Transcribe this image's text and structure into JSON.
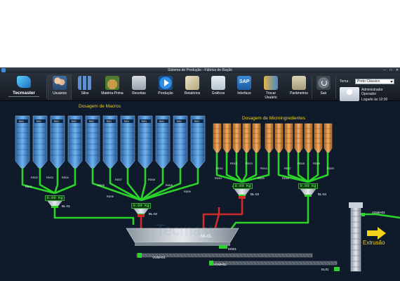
{
  "window": {
    "title": "Sistema de Produção - Fábrica de Ração"
  },
  "toolbar": {
    "logo": "Tecmaster",
    "buttons": [
      {
        "id": "usuarios",
        "label": "Usuários",
        "icon": "users-icon"
      },
      {
        "id": "silos",
        "label": "Silos",
        "icon": "silos-icon"
      },
      {
        "id": "materia_prima",
        "label": "Matéria-Prima",
        "icon": "raw-material-icon"
      },
      {
        "id": "receitas",
        "label": "Receitas",
        "icon": "recipes-icon"
      },
      {
        "id": "producao",
        "label": "Produção",
        "icon": "play-icon"
      },
      {
        "id": "relatorios",
        "label": "Relatórios",
        "icon": "reports-icon"
      },
      {
        "id": "graficos",
        "label": "Gráficos",
        "icon": "charts-icon"
      },
      {
        "id": "interface",
        "label": "Interface",
        "icon": "sap-icon"
      },
      {
        "id": "trocar_usuario",
        "label": "Trocar\nUsuário",
        "icon": "switch-user-icon"
      },
      {
        "id": "parametros",
        "label": "Parâmetros",
        "icon": "settings-icon"
      },
      {
        "id": "sair",
        "label": "Sair",
        "icon": "power-icon"
      }
    ],
    "sap_text": "SAP",
    "tema_label": "Tema :",
    "tema_value": "Preto Clássico",
    "user_name": "Administrador",
    "user_role": "Operador",
    "login_time": "Logado às 12:00"
  },
  "scada": {
    "macros_title": "Dosagem de Macros",
    "micro_title": "Dosagem de Microingredientes",
    "silo_macro_labels": [
      "Si01",
      "Si01",
      "Si01",
      "Si01",
      "Si01",
      "Si01",
      "Si01",
      "Si01",
      "Si01",
      "Si01",
      "Si01"
    ],
    "weights": [
      "0.00",
      "0.00",
      "0.00",
      "0.00"
    ],
    "weight_unit": "Kg",
    "valves": {
      "macro_left": [
        "RD01",
        "RD02",
        "RD03",
        "RD04"
      ],
      "macro_mid": [
        "RD05",
        "RD06",
        "RD07",
        "RD08",
        "RD09"
      ],
      "bl03": [
        "RD10",
        "RD11",
        "RD12",
        "RD13",
        "RD14",
        "RD15"
      ],
      "bl04": [
        "RD16",
        "RD17",
        "RD18",
        "RD19",
        "RD20"
      ]
    },
    "balances": [
      "BL-01",
      "BL-02",
      "BL-03",
      "BL-04"
    ],
    "mixer": "MI-01",
    "motor": "MH01",
    "gates": [
      "VGMH01",
      "VGMH02",
      "VGMH03"
    ],
    "elevator": "EL01",
    "extrusion": "Extrusão",
    "watermark": "Tecmaster",
    "colors": {
      "active_pipe": "#2bd32b",
      "inactive_pipe": "#d02a2a",
      "silo_macro": "#3e86d6",
      "silo_micro": "#e0913c",
      "title_yellow": "#f3d21a"
    }
  }
}
